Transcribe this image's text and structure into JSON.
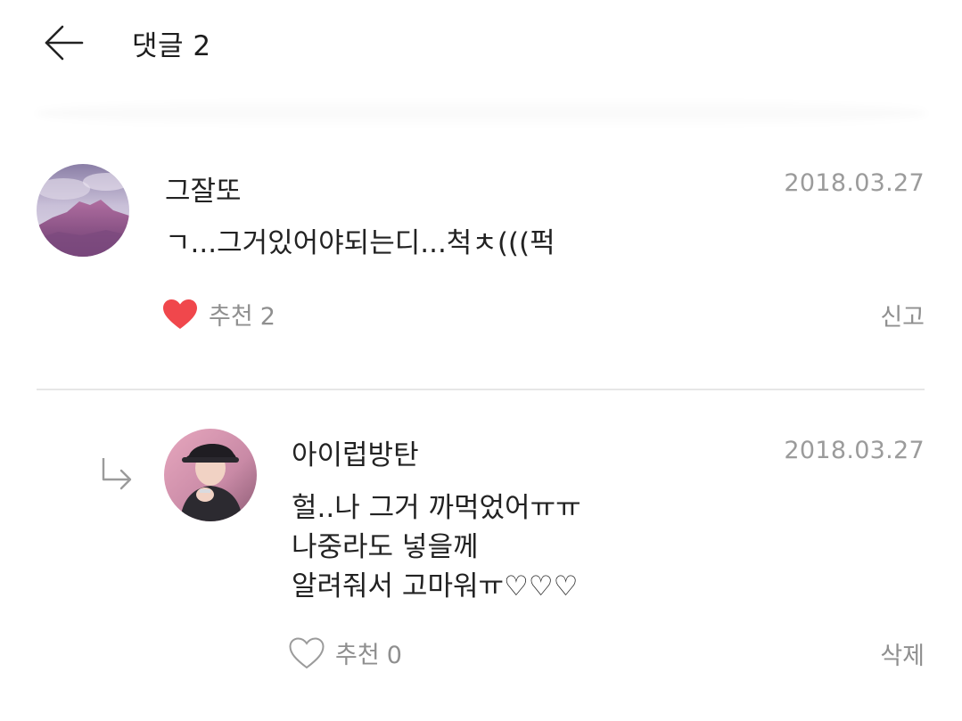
{
  "header": {
    "title": "댓글 2",
    "back_icon": "arrow-left-icon"
  },
  "comments": [
    {
      "author": "그잘또",
      "date": "2018.03.27",
      "text": "ㄱ...그거있어야되는디...척ㅊ(((퍽",
      "liked": true,
      "like_label": "추천",
      "like_count": "2",
      "action_label": "신고"
    },
    {
      "is_reply": true,
      "author": "아이럽방탄",
      "date": "2018.03.27",
      "text": "헐..나 그거 까먹었어ㅠㅠ\n나중라도 넣을께\n알려줘서 고마워ㅠ♡♡♡",
      "liked": false,
      "like_label": "추천",
      "like_count": "0",
      "action_label": "삭제"
    }
  ],
  "colors": {
    "heart_active": "#f0474c",
    "heart_inactive": "#9b9b9b",
    "muted_text": "#8f8f8f",
    "divider": "#e6e6e6"
  }
}
